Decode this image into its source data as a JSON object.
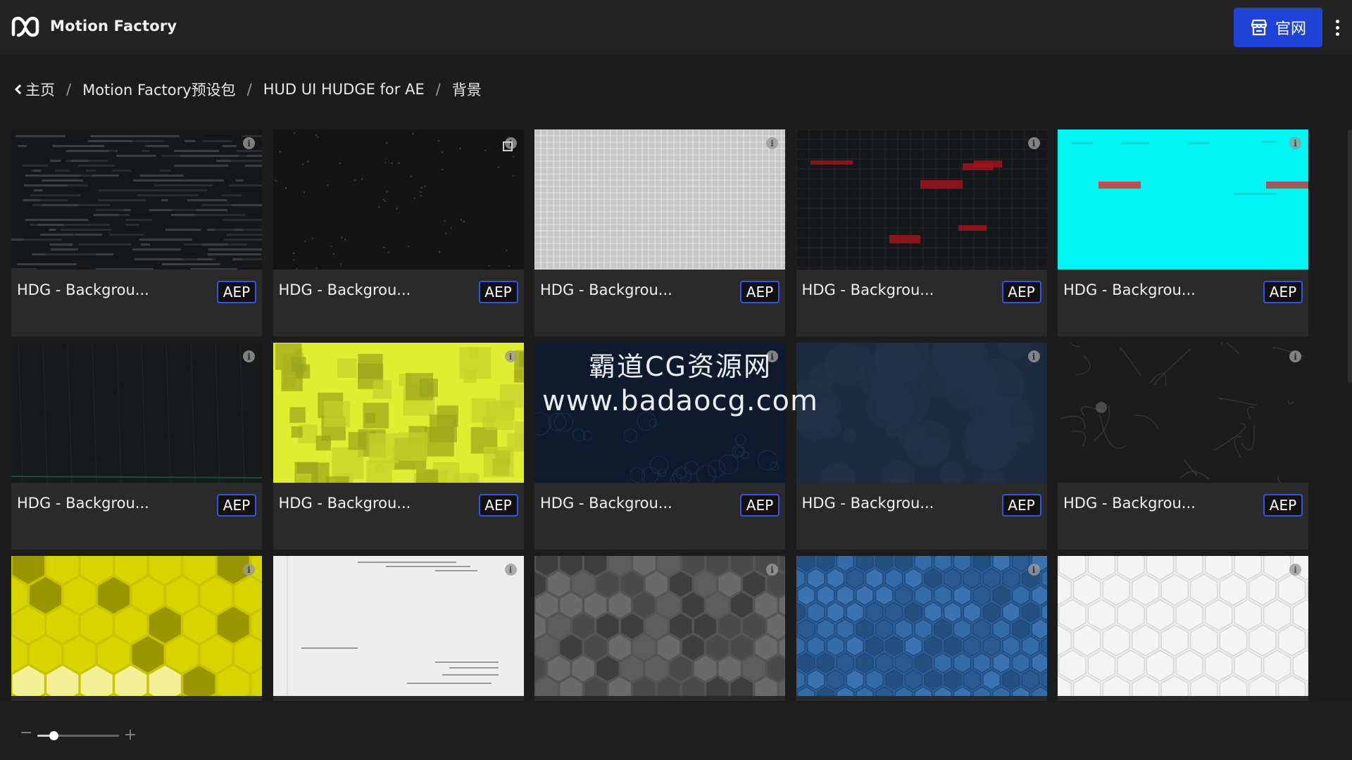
{
  "header": {
    "app_title": "Motion Factory",
    "official_site_label": "官网",
    "logo_icon": "motion-factory-logo",
    "more_icon": "more-vertical-icon",
    "accent_color": "#1f43d9"
  },
  "breadcrumb": {
    "items": [
      "主页",
      "Motion Factory预设包",
      "HUD UI HUDGE for AE",
      "背景"
    ],
    "separator": "/"
  },
  "cards": [
    {
      "title": "HDG - Backgrou...",
      "badge": "AEP",
      "thumb": "dark-data-lines"
    },
    {
      "title": "HDG - Backgrou...",
      "badge": "AEP",
      "thumb": "dark-specks",
      "copy_icon": true
    },
    {
      "title": "HDG - Backgrou...",
      "badge": "AEP",
      "thumb": "light-grid"
    },
    {
      "title": "HDG - Backgrou...",
      "badge": "AEP",
      "thumb": "dark-red-bars"
    },
    {
      "title": "HDG - Backgrou...",
      "badge": "AEP",
      "thumb": "cyan-bars"
    },
    {
      "title": "HDG - Backgrou...",
      "badge": "AEP",
      "thumb": "dark-wire"
    },
    {
      "title": "HDG - Backgrou...",
      "badge": "AEP",
      "thumb": "yellow-squares"
    },
    {
      "title": "HDG - Backgrou...",
      "badge": "AEP",
      "thumb": "navy-map"
    },
    {
      "title": "HDG - Backgrou...",
      "badge": "AEP",
      "thumb": "navy-texture"
    },
    {
      "title": "HDG - Backgrou...",
      "badge": "AEP",
      "thumb": "dark-veins"
    },
    {
      "title": "",
      "badge": "",
      "thumb": "yellow-hex"
    },
    {
      "title": "",
      "badge": "",
      "thumb": "white-lines"
    },
    {
      "title": "",
      "badge": "",
      "thumb": "grey-hex"
    },
    {
      "title": "",
      "badge": "",
      "thumb": "blue-hex"
    },
    {
      "title": "",
      "badge": "",
      "thumb": "white-hex"
    }
  ],
  "watermark": {
    "line1": "霸道CG资源网",
    "line2": "www.badaocg.com"
  },
  "zoom": {
    "minus_icon": "zoom-out-icon",
    "plus_icon": "zoom-in-icon",
    "level": 0.2
  }
}
